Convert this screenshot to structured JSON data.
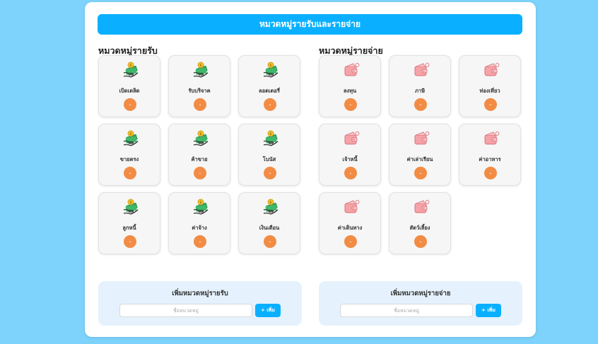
{
  "header": {
    "title": "หมวดหมู่รายรับและรายจ่าย"
  },
  "income": {
    "title": "หมวดหมู่รายรับ",
    "icon": "money-hand-icon",
    "items": [
      {
        "name": "เบิดเตลิด",
        "delete_label": "-"
      },
      {
        "name": "รับบริจาค",
        "delete_label": "-"
      },
      {
        "name": "ลอตเตอรี่",
        "delete_label": "-"
      },
      {
        "name": "ขายตรง",
        "delete_label": "-"
      },
      {
        "name": "ค้าขาย",
        "delete_label": "-"
      },
      {
        "name": "โบนัส",
        "delete_label": "-"
      },
      {
        "name": "ลูกหนี้",
        "delete_label": "-"
      },
      {
        "name": "ค่าจ้าง",
        "delete_label": "-"
      },
      {
        "name": "เงินเดือน",
        "delete_label": "-"
      }
    ]
  },
  "expense": {
    "title": "หมวดหมู่รายจ่าย",
    "icon": "wallet-icon",
    "items": [
      {
        "name": "ลงทุน",
        "delete_label": "-"
      },
      {
        "name": "ภาษี",
        "delete_label": "-"
      },
      {
        "name": "ท่องเที่ยว",
        "delete_label": "-"
      },
      {
        "name": "เจ้าหนี้",
        "delete_label": "-"
      },
      {
        "name": "ค่าเล่าเรียน",
        "delete_label": "-"
      },
      {
        "name": "ค่าอาหาร",
        "delete_label": "-"
      },
      {
        "name": "ค่าเดินทาง",
        "delete_label": "-"
      },
      {
        "name": "สัตว์เลี้ยง",
        "delete_label": "-"
      }
    ]
  },
  "add_income": {
    "title": "เพิ่มหมวดหมู่รายรับ",
    "placeholder": "ชื่อหมวดหมู่",
    "value": "",
    "button": "+ เพิ่ม"
  },
  "add_expense": {
    "title": "เพิ่มหมวดหมู่รายจ่าย",
    "placeholder": "ชื่อหมวดหมู่",
    "value": "",
    "button": "+ เพิ่ม"
  },
  "colors": {
    "background": "#7dd3fb",
    "accent": "#0ab0ff",
    "delete": "#f28c45",
    "add_box": "#e5f2fd"
  }
}
